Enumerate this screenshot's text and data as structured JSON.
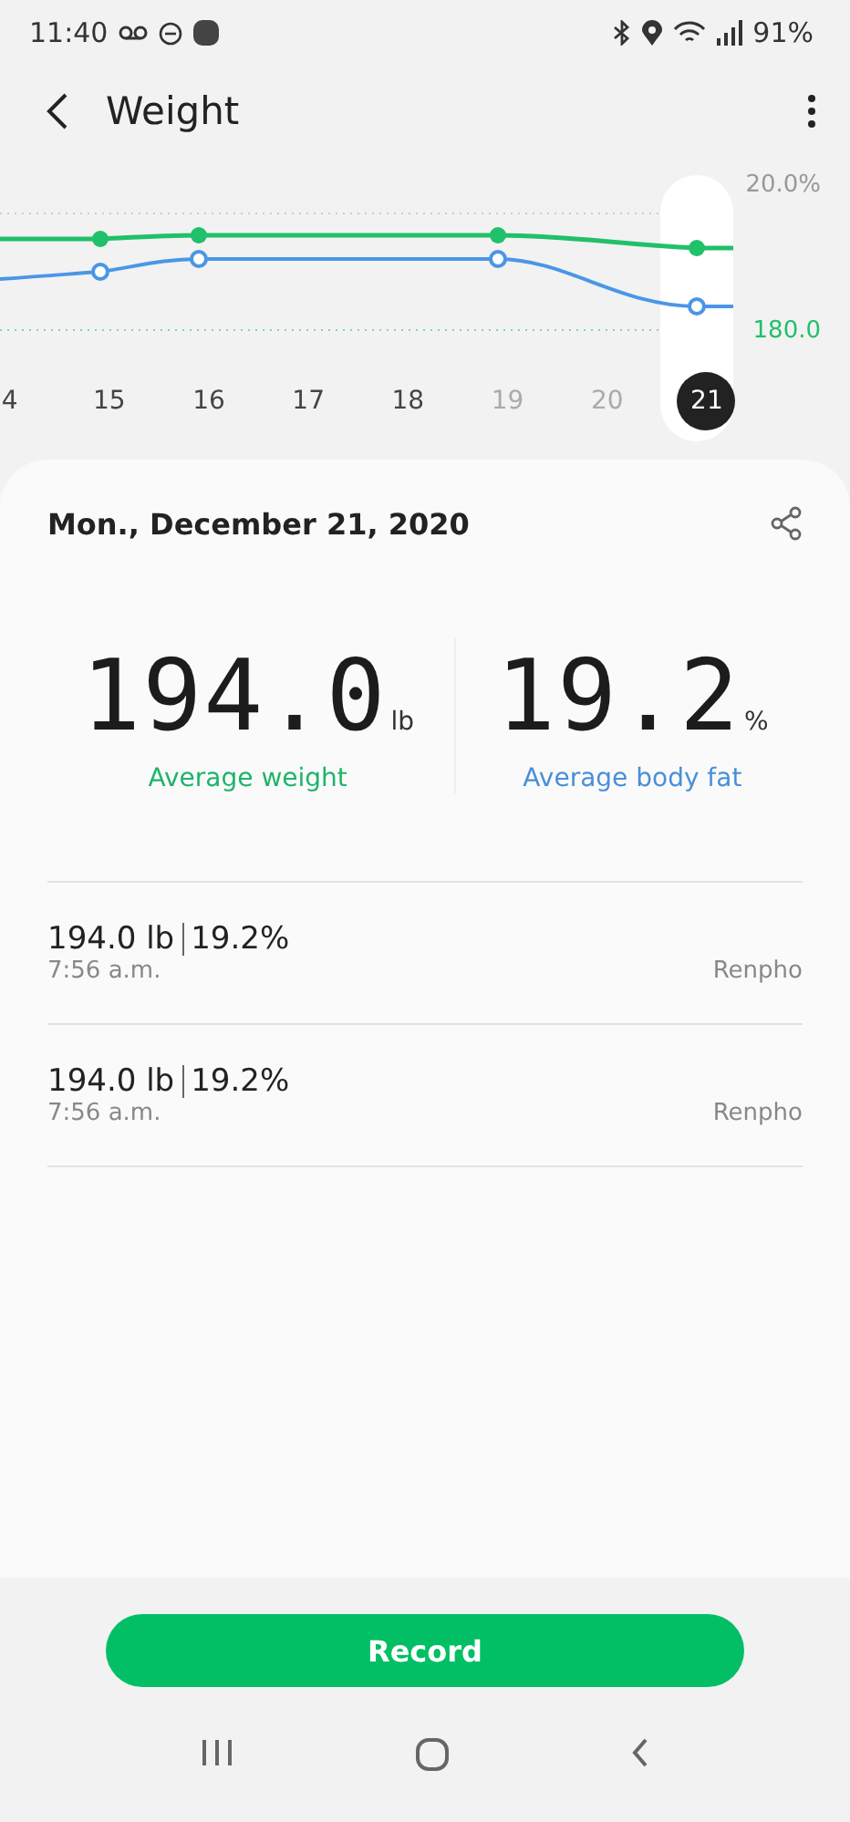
{
  "status_bar": {
    "time": "11:40",
    "battery": "91%"
  },
  "header": {
    "title": "Weight"
  },
  "chart": {
    "top_label": "20.0%",
    "bottom_label": "180.0",
    "days": [
      {
        "label": "4",
        "selected": false,
        "dimmed": false
      },
      {
        "label": "15",
        "selected": false,
        "dimmed": false
      },
      {
        "label": "16",
        "selected": false,
        "dimmed": false
      },
      {
        "label": "17",
        "selected": false,
        "dimmed": false
      },
      {
        "label": "18",
        "selected": false,
        "dimmed": false
      },
      {
        "label": "19",
        "selected": false,
        "dimmed": true
      },
      {
        "label": "20",
        "selected": false,
        "dimmed": true
      },
      {
        "label": "21",
        "selected": true,
        "dimmed": false
      }
    ]
  },
  "summary": {
    "date": "Mon., December 21, 2020",
    "metrics": [
      {
        "value": "194.0",
        "unit": "lb",
        "label": "Average weight",
        "color": "#1fb46a"
      },
      {
        "value": "19.2",
        "unit": "%",
        "label": "Average body fat",
        "color": "#4a8fd8"
      }
    ]
  },
  "records": [
    {
      "weight": "194.0 lb",
      "fat": "19.2%",
      "time": "7:56 a.m.",
      "source": "Renpho"
    },
    {
      "weight": "194.0 lb",
      "fat": "19.2%",
      "time": "7:56 a.m.",
      "source": "Renpho"
    }
  ],
  "record_button": "Record"
}
